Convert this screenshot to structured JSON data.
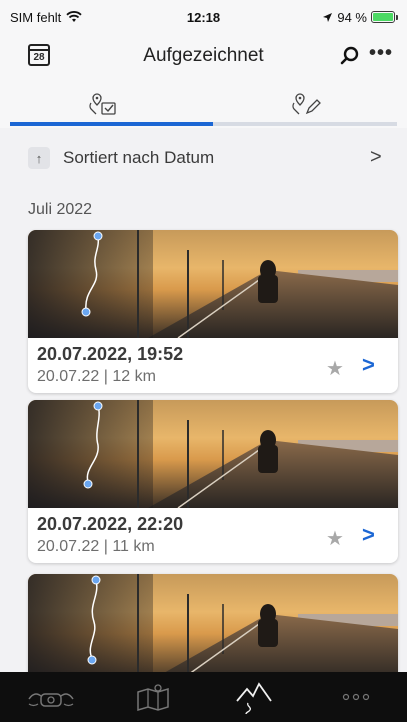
{
  "status_bar": {
    "carrier": "SIM fehlt",
    "time": "12:18",
    "battery": "94 %"
  },
  "header": {
    "calendar_day": "28",
    "title": "Aufgezeichnet"
  },
  "tabs": [
    {
      "icon": "recorded-routes-icon",
      "active": true
    },
    {
      "icon": "planned-routes-icon",
      "active": false
    }
  ],
  "sort": {
    "label": "Sortiert nach Datum"
  },
  "month": "Juli 2022",
  "trips": [
    {
      "title": "20.07.2022, 19:52",
      "subtitle": "20.07.22 | 12 km"
    },
    {
      "title": "20.07.2022, 22:20",
      "subtitle": "20.07.22 | 11 km"
    },
    {
      "title": "",
      "subtitle": ""
    }
  ],
  "tab_bar": [
    {
      "icon": "motorcycle-cockpit-icon",
      "active": false
    },
    {
      "icon": "map-icon",
      "active": false
    },
    {
      "icon": "mountain-route-icon",
      "active": true
    },
    {
      "icon": "more-dots-icon",
      "active": false
    }
  ],
  "colors": {
    "accent": "#1c67d4",
    "tabbar_bg": "#0e0e0e",
    "background": "#f2f2f4"
  }
}
